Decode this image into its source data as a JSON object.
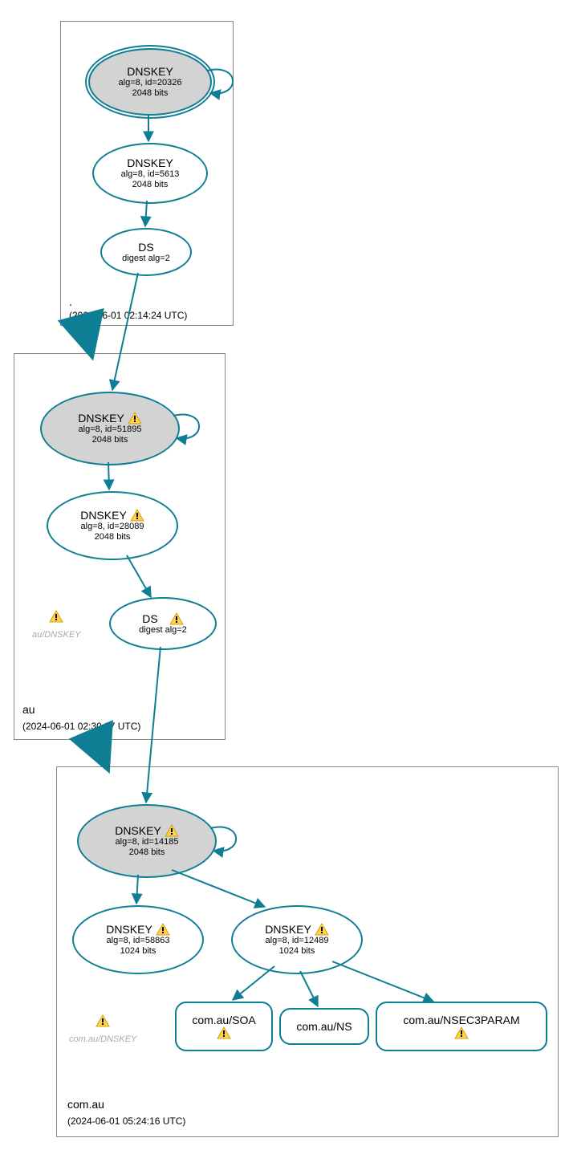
{
  "zones": {
    "root": {
      "name": ".",
      "timestamp": "(2024-06-01 02:14:24 UTC)"
    },
    "au": {
      "name": "au",
      "timestamp": "(2024-06-01 02:30:37 UTC)"
    },
    "comau": {
      "name": "com.au",
      "timestamp": "(2024-06-01 05:24:16 UTC)"
    }
  },
  "nodes": {
    "root_ksk": {
      "title": "DNSKEY",
      "l1": "alg=8, id=20326",
      "l2": "2048 bits"
    },
    "root_zsk": {
      "title": "DNSKEY",
      "l1": "alg=8, id=5613",
      "l2": "2048 bits"
    },
    "root_ds": {
      "title": "DS",
      "l1": "digest alg=2"
    },
    "au_ksk": {
      "title": "DNSKEY",
      "l1": "alg=8, id=51895",
      "l2": "2048 bits"
    },
    "au_zsk": {
      "title": "DNSKEY",
      "l1": "alg=8, id=28089",
      "l2": "2048 bits"
    },
    "au_ds": {
      "title": "DS",
      "l1": "digest alg=2"
    },
    "au_warn_label": "au/DNSKEY",
    "comau_ksk": {
      "title": "DNSKEY",
      "l1": "alg=8, id=14185",
      "l2": "2048 bits"
    },
    "comau_zsk1": {
      "title": "DNSKEY",
      "l1": "alg=8, id=58863",
      "l2": "1024 bits"
    },
    "comau_zsk2": {
      "title": "DNSKEY",
      "l1": "alg=8, id=12489",
      "l2": "1024 bits"
    },
    "comau_soa": "com.au/SOA",
    "comau_ns": "com.au/NS",
    "comau_nsec3": "com.au/NSEC3PARAM",
    "comau_warn_label": "com.au/DNSKEY"
  }
}
